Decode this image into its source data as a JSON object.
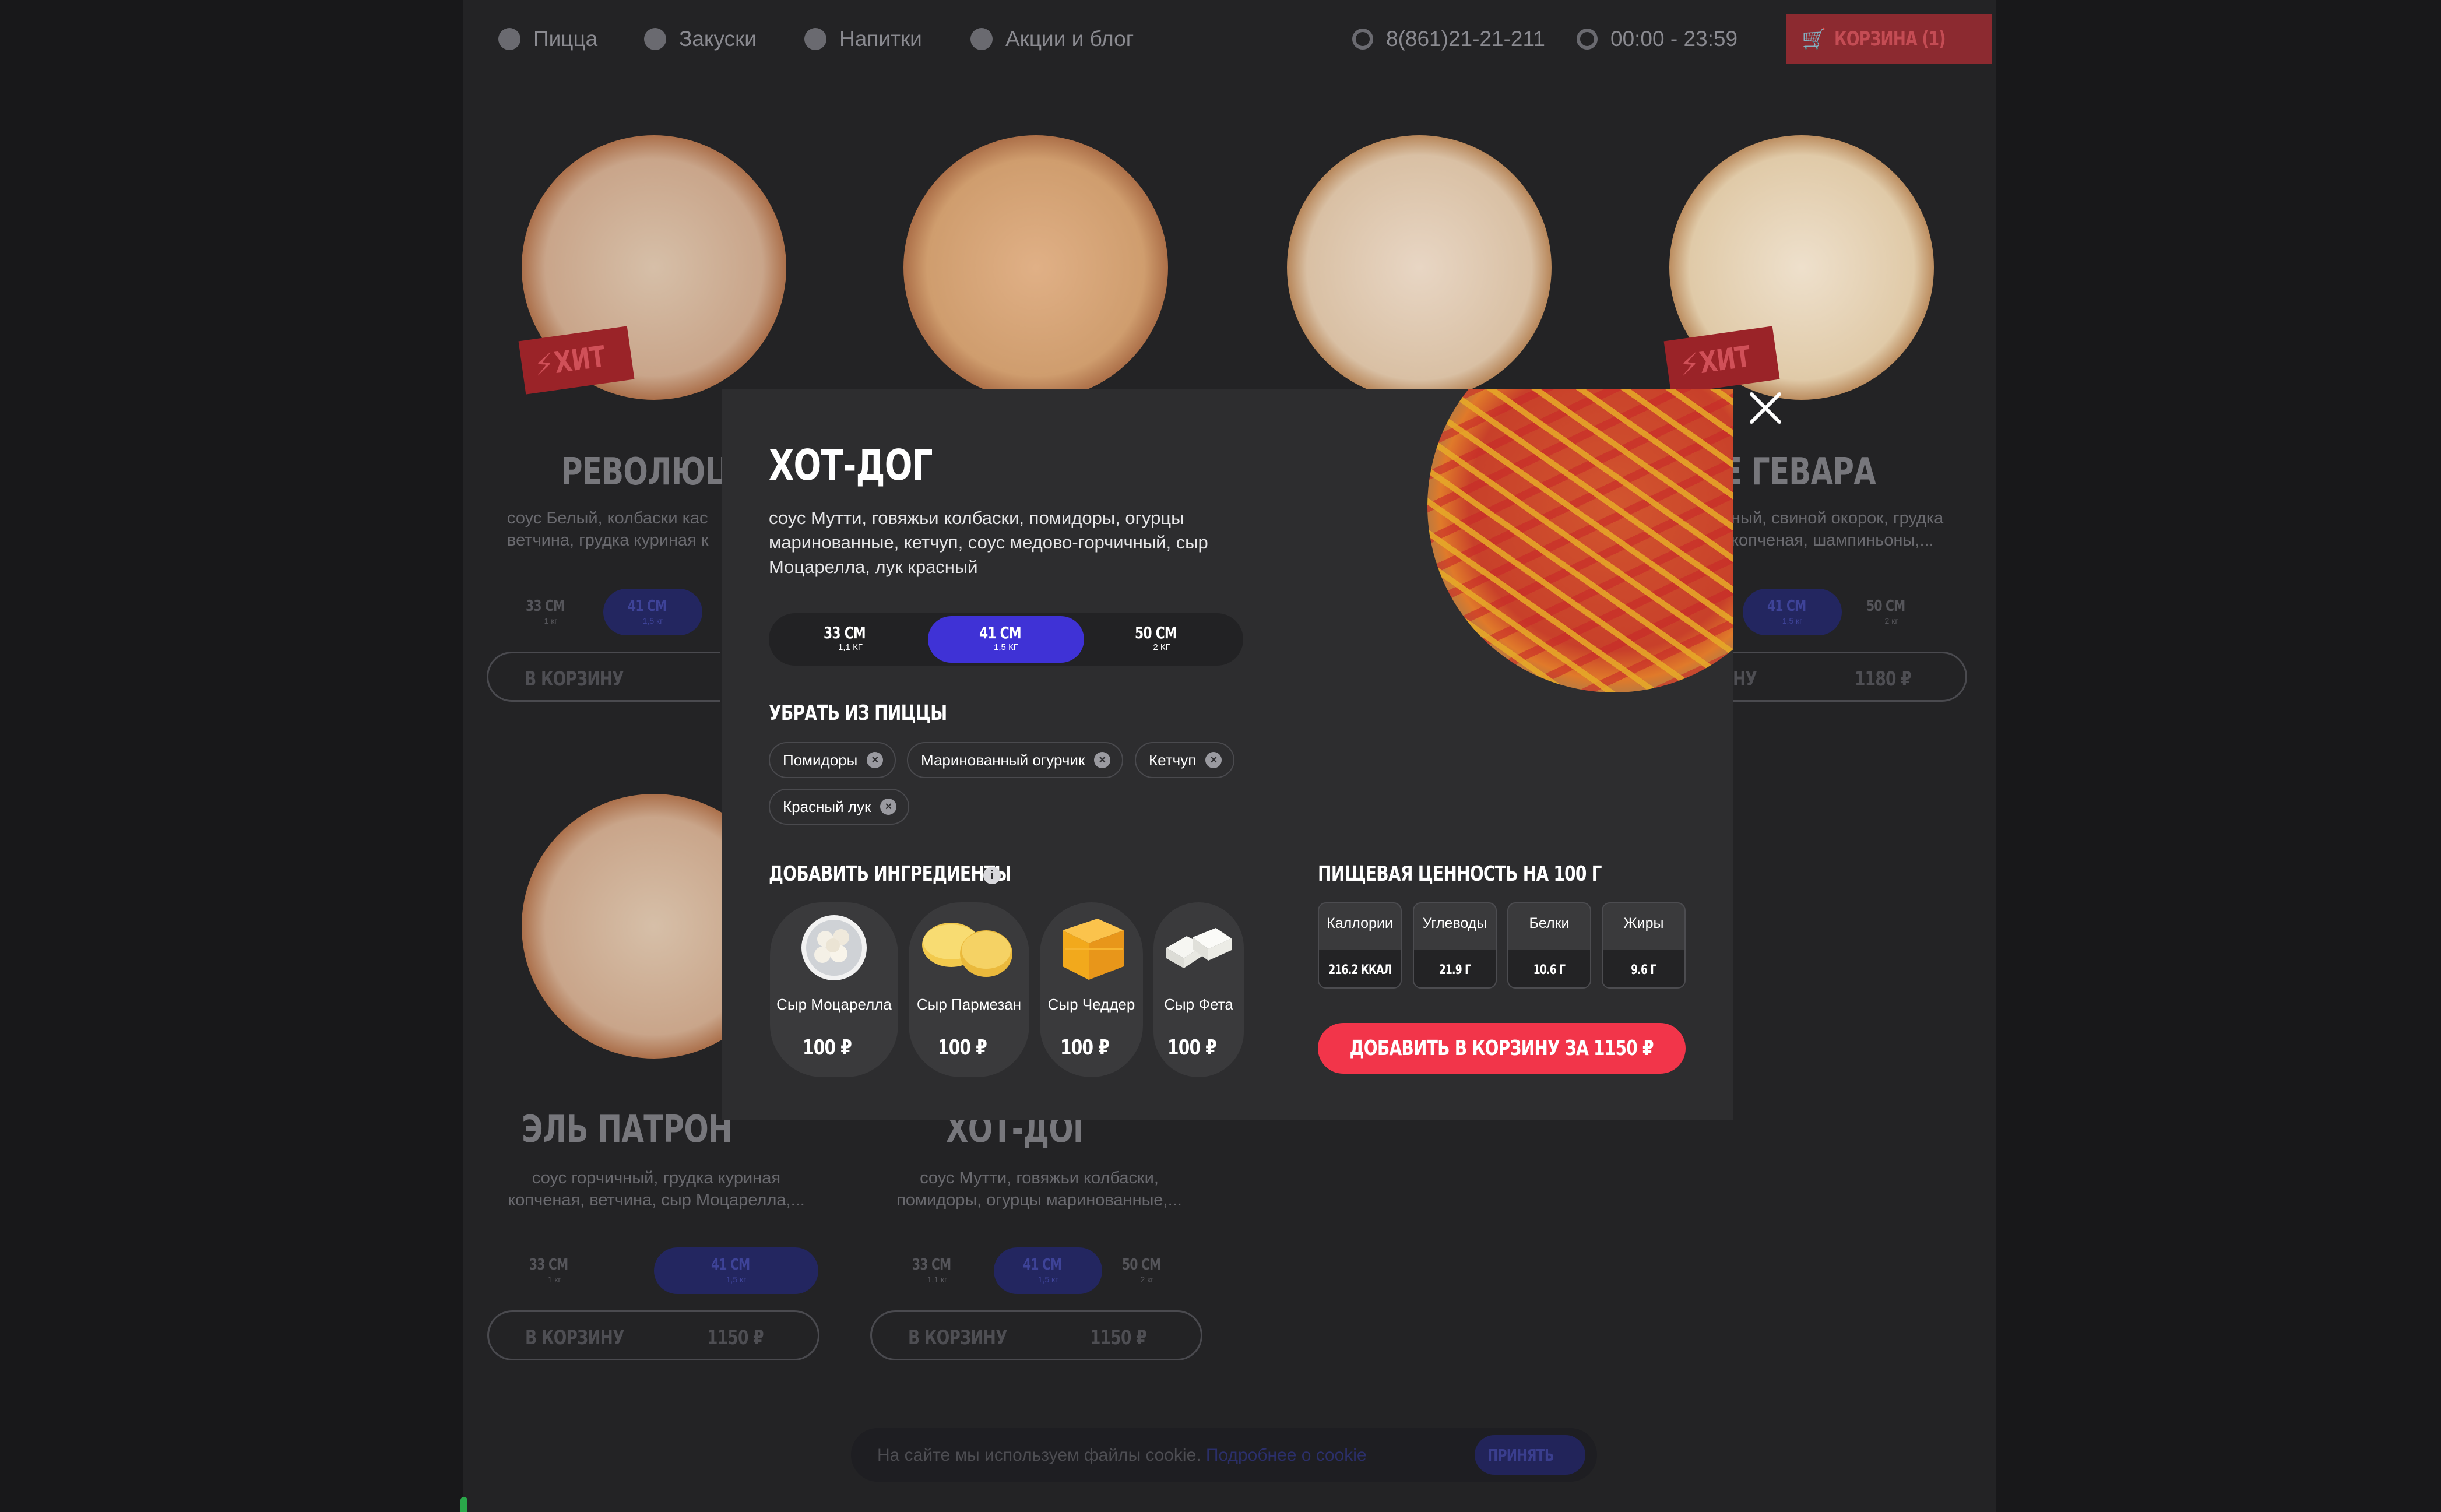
{
  "header": {
    "nav": [
      {
        "label": "Пицца",
        "icon": "pizza-icon"
      },
      {
        "label": "Закуски",
        "icon": "snack-icon"
      },
      {
        "label": "Напитки",
        "icon": "drink-icon"
      },
      {
        "label": "Акции и блог",
        "icon": "fire-icon"
      }
    ],
    "phone": "8(861)21-21-211",
    "hours": "00:00 - 23:59",
    "cart_label": "КОРЗИНА (1)"
  },
  "cards": [
    {
      "title": "РЕВОЛЮЦИ",
      "desc": "соус Белый, колбаски кас ветчина, грудка куриная к",
      "hit": "ХИТ",
      "sizes": [
        {
          "label": "33 СМ",
          "weight": "1 кг"
        },
        {
          "label": "41 СМ",
          "weight": "1,5 кг"
        }
      ],
      "buy": "В КОРЗИНУ",
      "price": ""
    },
    {
      "title": "",
      "desc": "",
      "hit": "",
      "sizes": [],
      "buy": "",
      "price": ""
    },
    {
      "title": "",
      "desc": "",
      "hit": "",
      "sizes": [],
      "buy": "",
      "price": ""
    },
    {
      "title": "Е ГЕВАРА",
      "desc": "ный, свиной окорок, грудка копченая, шампиньоны,...",
      "hit": "ХИТ",
      "sizes": [
        {
          "label": "41 СМ",
          "weight": "1,5 кг"
        },
        {
          "label": "50 СМ",
          "weight": "2 кг"
        }
      ],
      "buy": "НУ",
      "price": "1180 ₽"
    },
    {
      "title": "ЭЛЬ ПАТРОН",
      "desc": "соус горчичный, грудка куриная копченая, ветчина, сыр Моцарелла,...",
      "hit": "",
      "sizes": [
        {
          "label": "33 СМ",
          "weight": "1 кг"
        },
        {
          "label": "41 СМ",
          "weight": "1,5 кг"
        }
      ],
      "buy": "В КОРЗИНУ",
      "price": "1150 ₽"
    },
    {
      "title": "ХОТ-ДОГ",
      "desc": "соус Мутти, говяжьи колбаски, помидоры, огурцы маринованные,...",
      "hit": "",
      "sizes": [
        {
          "label": "33 СМ",
          "weight": "1,1 кг"
        },
        {
          "label": "41 СМ",
          "weight": "1,5 кг"
        },
        {
          "label": "50 СМ",
          "weight": "2 кг"
        }
      ],
      "buy": "В КОРЗИНУ",
      "price": "1150 ₽"
    }
  ],
  "cookie": {
    "text": "На сайте мы используем файлы cookie.",
    "link": "Подробнее о cookie",
    "accept": "ПРИНЯТЬ"
  },
  "modal": {
    "title": "ХОТ-ДОГ",
    "description": "соус Мутти, говяжьи колбаски, помидоры, огурцы маринованные, кетчуп, соус медово-горчичный, сыр Моцарелла, лук красный",
    "sizes": [
      {
        "label": "33 СМ",
        "weight": "1,1 КГ",
        "selected": false
      },
      {
        "label": "41 СМ",
        "weight": "1,5 КГ",
        "selected": true
      },
      {
        "label": "50 СМ",
        "weight": "2 КГ",
        "selected": false
      }
    ],
    "remove_title": "УБРАТЬ ИЗ ПИЦЦЫ",
    "remove_items": [
      "Помидоры",
      "Маринованный огурчик",
      "Кетчуп",
      "Красный лук"
    ],
    "add_title": "ДОБАВИТЬ ИНГРЕДИЕНТЫ",
    "ingredients": [
      {
        "name": "Сыр  Моцарелла",
        "price": "100 ₽",
        "icon": "mozzarella-icon"
      },
      {
        "name": "Сыр  Пармезан",
        "price": "100 ₽",
        "icon": "parmesan-icon"
      },
      {
        "name": "Сыр  Чеддер",
        "price": "100 ₽",
        "icon": "cheddar-icon"
      },
      {
        "name": "Сыр  Фета",
        "price": "100 ₽",
        "icon": "feta-icon"
      }
    ],
    "nutrition_title": "ПИЩЕВАЯ ЦЕННОСТЬ НА 100 Г",
    "nutrition": [
      {
        "label": "Каллории",
        "value": "216.2 ККАЛ"
      },
      {
        "label": "Углеводы",
        "value": "21.9 Г"
      },
      {
        "label": "Белки",
        "value": "10.6 Г"
      },
      {
        "label": "Жиры",
        "value": "9.6 Г"
      }
    ],
    "add_to_cart": "ДОБАВИТЬ В КОРЗИНУ ЗА 1150 ₽"
  },
  "colors": {
    "accent": "#f2354a",
    "selected": "#3f32d6",
    "modal_bg": "#2d2d2f",
    "page_bg": "#18181a"
  }
}
